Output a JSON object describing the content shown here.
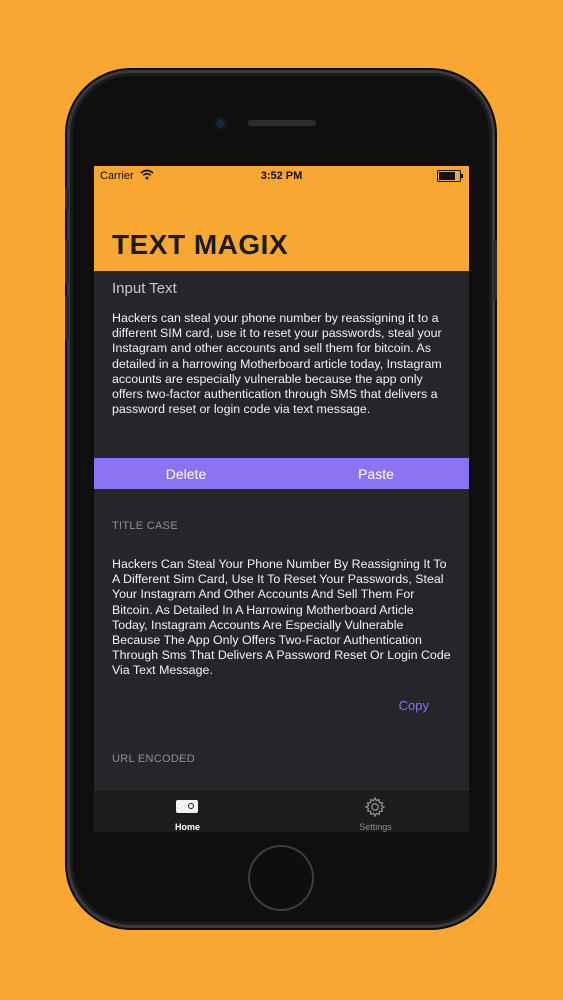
{
  "status_bar": {
    "carrier": "Carrier",
    "time": "3:52 PM",
    "battery_level": 0.9
  },
  "header": {
    "title": "TEXT MAGIX"
  },
  "input": {
    "label": "Input Text",
    "text": "Hackers can steal your phone number by reassigning it to a different SIM card, use it to reset your passwords, steal your Instagram  and other accounts and sell them for bitcoin. As detailed in a harrowing Motherboard article today, Instagram accounts are especially vulnerable because the app only offers two-factor authentication through SMS that delivers a password reset or login code via text message."
  },
  "actions": {
    "delete_label": "Delete",
    "paste_label": "Paste"
  },
  "results": [
    {
      "heading": "TITLE CASE",
      "text": "Hackers Can Steal Your Phone Number By Reassigning It To A Different Sim Card, Use It To Reset Your Passwords, Steal Your Instagram  And Other Accounts And Sell Them For Bitcoin. As Detailed In A Harrowing Motherboard Article Today, Instagram Accounts Are Especially Vulnerable Because The App Only Offers Two-Factor Authentication Through Sms That Delivers A Password Reset Or Login Code Via Text Message.",
      "copy_label": "Copy"
    },
    {
      "heading": "URL ENCODED"
    }
  ],
  "tabbar": {
    "tabs": [
      {
        "label": "Home",
        "icon": "search-icon",
        "active": true
      },
      {
        "label": "Settings",
        "icon": "gear-icon",
        "active": false
      }
    ]
  },
  "colors": {
    "background": "#F8A832",
    "accent": "#8B73F2",
    "screen_bg": "#26252a"
  }
}
